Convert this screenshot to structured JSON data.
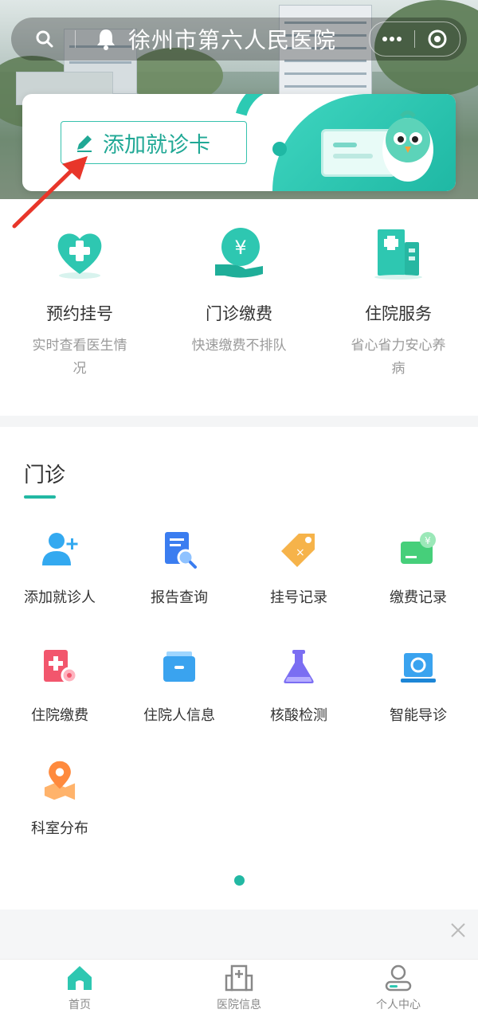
{
  "header": {
    "title": "徐州市第六人民医院",
    "search_icon": "search-icon",
    "bell_icon": "bell-icon",
    "more_icon": "more-dots-icon",
    "target_icon": "target-circle-icon"
  },
  "card": {
    "add_card_label": "添加就诊卡",
    "accent_color": "#22b8a3"
  },
  "services": [
    {
      "name": "预约挂号",
      "desc": "实时查看医生情况",
      "icon": "heart-plus-icon"
    },
    {
      "name": "门诊缴费",
      "desc": "快速缴费不排队",
      "icon": "yen-coin-hand-icon"
    },
    {
      "name": "住院服务",
      "desc": "省心省力安心养病",
      "icon": "hospital-building-icon"
    }
  ],
  "outpatient": {
    "section_title": "门诊",
    "items": [
      {
        "label": "添加就诊人",
        "icon": "add-person-icon"
      },
      {
        "label": "报告查询",
        "icon": "report-search-icon"
      },
      {
        "label": "挂号记录",
        "icon": "tag-record-icon"
      },
      {
        "label": "缴费记录",
        "icon": "payment-card-icon"
      },
      {
        "label": "住院缴费",
        "icon": "inpatient-payment-icon"
      },
      {
        "label": "住院人信息",
        "icon": "inpatient-info-icon"
      },
      {
        "label": "核酸检测",
        "icon": "flask-icon"
      },
      {
        "label": "智能导诊",
        "icon": "smart-guide-icon"
      },
      {
        "label": "科室分布",
        "icon": "map-pin-icon"
      }
    ]
  },
  "tabbar": {
    "items": [
      {
        "label": "首页",
        "icon": "home-icon"
      },
      {
        "label": "医院信息",
        "icon": "hospital-icon"
      },
      {
        "label": "个人中心",
        "icon": "user-icon"
      }
    ]
  }
}
